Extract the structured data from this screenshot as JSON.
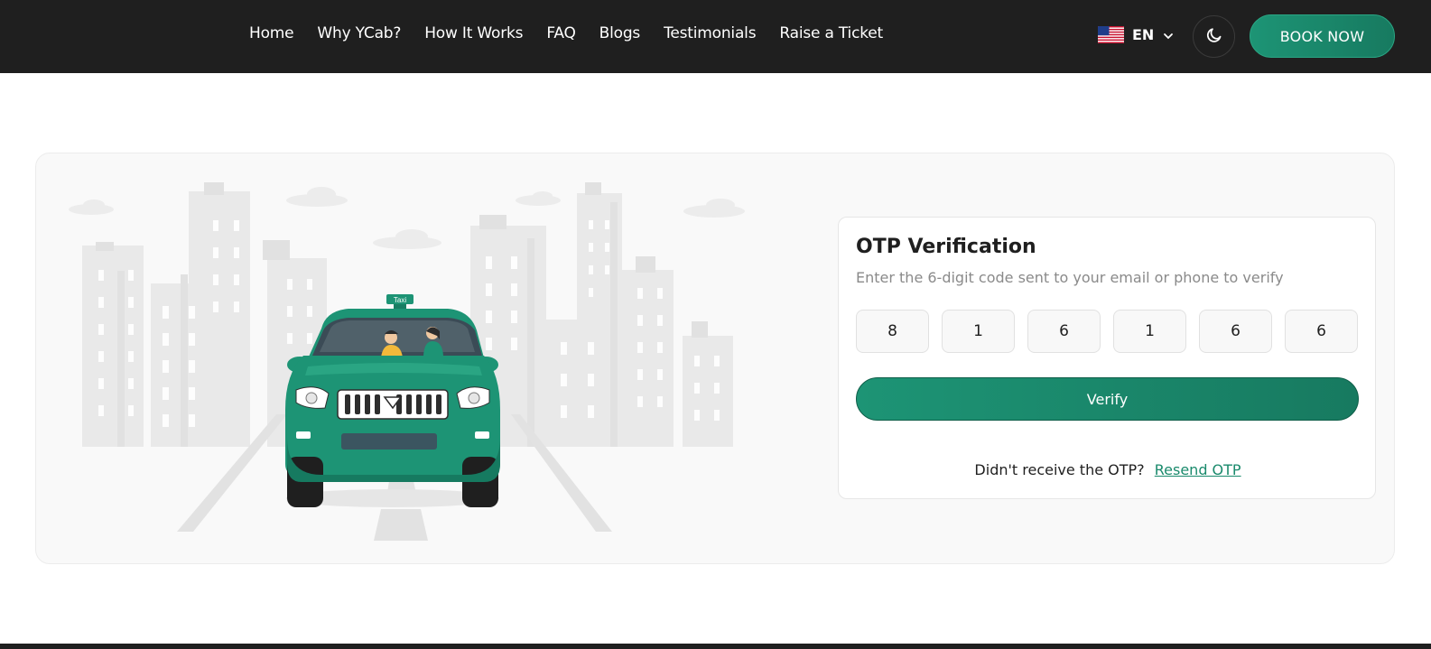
{
  "nav": {
    "items": [
      {
        "label": "Home"
      },
      {
        "label": "Why YCab?"
      },
      {
        "label": "How It Works"
      },
      {
        "label": "FAQ"
      },
      {
        "label": "Blogs"
      },
      {
        "label": "Testimonials"
      },
      {
        "label": "Raise a Ticket"
      }
    ]
  },
  "lang": {
    "code": "EN",
    "flag_icon": "us-flag-icon"
  },
  "header": {
    "theme_icon": "moon-icon",
    "book_label": "BOOK NOW"
  },
  "otp": {
    "title": "OTP Verification",
    "subtitle": "Enter the 6-digit code sent to your email or phone to verify",
    "digits": [
      "8",
      "1",
      "6",
      "1",
      "6",
      "6"
    ],
    "verify_label": "Verify",
    "resend_prompt": "Didn't receive the OTP?",
    "resend_link": "Resend OTP"
  },
  "illustration": {
    "taxi_sign": "Taxi"
  },
  "colors": {
    "accent": "#1d9475",
    "topbar": "#1f1f1f",
    "card_bg": "#f9f9f9"
  }
}
